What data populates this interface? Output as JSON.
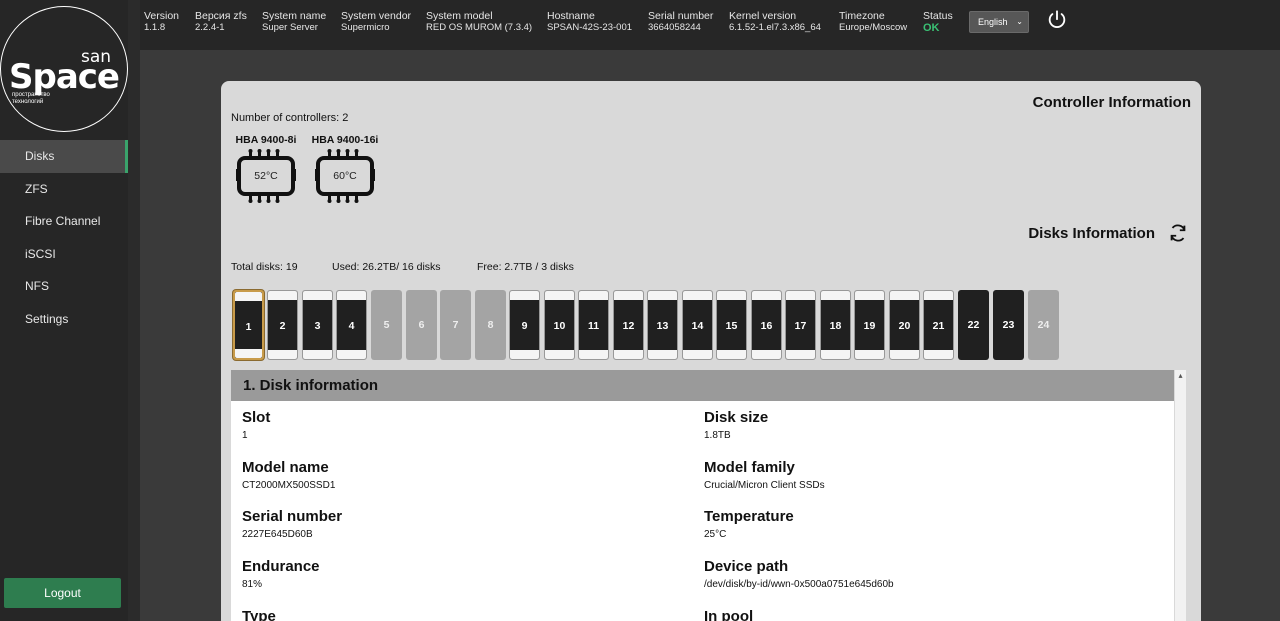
{
  "brand": {
    "small": "san",
    "big": "Space",
    "tagline": "пространство технологий"
  },
  "sidebar": {
    "items": [
      {
        "label": "Disks",
        "active": true
      },
      {
        "label": "ZFS"
      },
      {
        "label": "Fibre Channel"
      },
      {
        "label": "iSCSI"
      },
      {
        "label": "NFS"
      },
      {
        "label": "Settings"
      }
    ],
    "logout": "Logout"
  },
  "header": {
    "version_label": "Version",
    "version": "1.1.8",
    "zfs_label": "Версия zfs",
    "zfs": "2.2.4-1",
    "sysname_label": "System name",
    "sysname": "Super Server",
    "vendor_label": "System vendor",
    "vendor": "Supermicro",
    "model_label": "System model",
    "model": "RED OS MUROM (7.3.4)",
    "host_label": "Hostname",
    "host": "SPSAN-42S-23-001",
    "serial_label": "Serial number",
    "serial": "3664058244",
    "kernel_label": "Kernel version",
    "kernel": "6.1.52-1.el7.3.x86_64",
    "tz_label": "Timezone",
    "tz": "Europe/Moscow",
    "status_label": "Status",
    "status": "OK",
    "language": "English"
  },
  "controllers": {
    "title": "Controller Information",
    "count_text": "Number of controllers: 2",
    "list": [
      {
        "name": "HBA 9400-8i",
        "temp": "52°C"
      },
      {
        "name": "HBA 9400-16i",
        "temp": "60°C"
      }
    ]
  },
  "disks": {
    "title": "Disks Information",
    "total": "Total disks: 19",
    "used": "Used: 26.2TB/ 16 disks",
    "free": "Free: 2.7TB / 3 disks",
    "slots": [
      "1",
      "2",
      "3",
      "4",
      "5",
      "6",
      "7",
      "8",
      "9",
      "10",
      "11",
      "12",
      "13",
      "14",
      "15",
      "16",
      "17",
      "18",
      "19",
      "20",
      "21",
      "22",
      "23",
      "24"
    ]
  },
  "disk_info": {
    "heading": "1. Disk information",
    "slot_label": "Slot",
    "slot": "1",
    "size_label": "Disk size",
    "size": "1.8TB",
    "model_label": "Model name",
    "model": "CT2000MX500SSD1",
    "family_label": "Model family",
    "family": "Crucial/Micron Client SSDs",
    "serial_label": "Serial number",
    "serial": "2227E645D60B",
    "temp_label": "Temperature",
    "temp": "25°C",
    "endurance_label": "Endurance",
    "endurance": "81%",
    "path_label": "Device path",
    "path": "/dev/disk/by-id/wwn-0x500a0751e645d60b",
    "type_label": "Type",
    "pool_label": "In pool"
  },
  "colors": {
    "accent": "#3aa36b",
    "status_ok": "#3ac174",
    "logout": "#2e7d4f"
  }
}
